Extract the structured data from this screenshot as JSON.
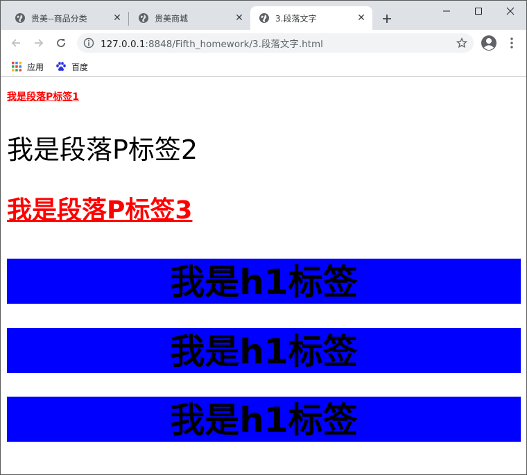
{
  "browser": {
    "tabs": [
      {
        "title": "贵美--商品分类",
        "active": false
      },
      {
        "title": "贵美商城",
        "active": false
      },
      {
        "title": "3.段落文字",
        "active": true
      }
    ],
    "new_tab_label": "+",
    "url_host": "127.0.0.1",
    "url_rest": ":8848/Fifth_homework/3.段落文字.html",
    "bookmarks": [
      {
        "label": "应用",
        "icon": "apps-grid-icon"
      },
      {
        "label": "百度",
        "icon": "baidu-paw-icon"
      }
    ]
  },
  "page": {
    "p1": "我是段落P标签1",
    "p2": "我是段落P标签2",
    "p3": "我是段落P标签3",
    "headings": [
      "我是h1标签",
      "我是h1标签",
      "我是h1标签"
    ]
  },
  "colors": {
    "tabstrip": "#dee1e6",
    "omnibox": "#f1f3f4",
    "red_text": "#ff0000",
    "h1_background": "#0000ff"
  }
}
